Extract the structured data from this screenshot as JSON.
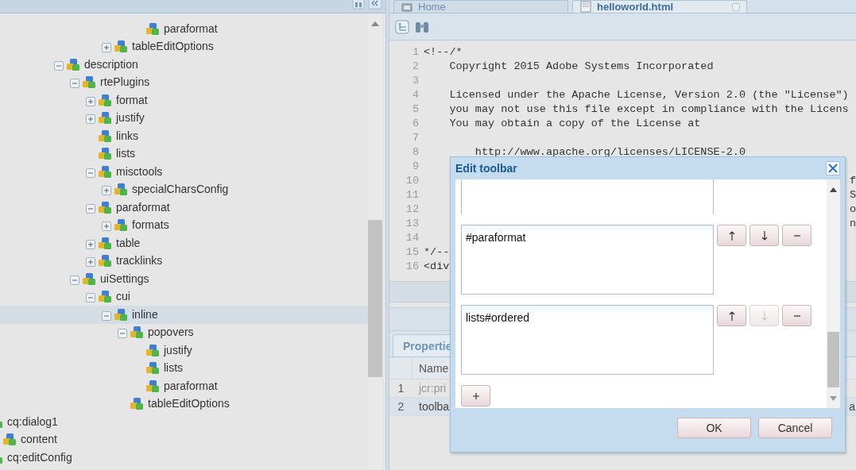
{
  "tree": [
    {
      "label": "paraformat",
      "selected": false
    },
    {
      "label": "tableEditOptions",
      "expanded": false,
      "selected": false
    },
    {
      "label": "description",
      "expanded": true,
      "selected": false,
      "children": [
        {
          "label": "rtePlugins",
          "expanded": true,
          "selected": false,
          "children": [
            {
              "label": "format",
              "expanded": false,
              "selected": false
            },
            {
              "label": "justify",
              "expanded": false,
              "selected": false
            },
            {
              "label": "links",
              "selected": false
            },
            {
              "label": "lists",
              "selected": false
            },
            {
              "label": "misctools",
              "expanded": true,
              "selected": false,
              "children": [
                {
                  "label": "specialCharsConfig",
                  "expanded": false,
                  "selected": false
                }
              ]
            },
            {
              "label": "paraformat",
              "expanded": true,
              "selected": false,
              "children": [
                {
                  "label": "formats",
                  "expanded": false,
                  "selected": false
                }
              ]
            },
            {
              "label": "table",
              "expanded": false,
              "selected": false
            },
            {
              "label": "tracklinks",
              "expanded": false,
              "selected": false
            }
          ]
        },
        {
          "label": "uiSettings",
          "expanded": true,
          "selected": false,
          "children": [
            {
              "label": "cui",
              "expanded": true,
              "selected": false,
              "children": [
                {
                  "label": "inline",
                  "expanded": true,
                  "selected": true,
                  "children": [
                    {
                      "label": "popovers",
                      "expanded": true,
                      "selected": false,
                      "children": [
                        {
                          "label": "justify",
                          "selected": false
                        },
                        {
                          "label": "lists",
                          "selected": false
                        },
                        {
                          "label": "paraformat",
                          "selected": false
                        }
                      ]
                    },
                    {
                      "label": "tableEditOptions",
                      "selected": false
                    }
                  ]
                }
              ]
            }
          ]
        }
      ]
    },
    {
      "label": "cq:dialog1",
      "selected": false
    },
    {
      "label": "content",
      "selected": false
    },
    {
      "label": "cq:editConfig",
      "selected": false
    }
  ],
  "tabs": [
    {
      "label": "Home",
      "kind": "home",
      "selected": false
    },
    {
      "label": "helloworld.html",
      "kind": "file",
      "selected": true
    }
  ],
  "code_lines": [
    {
      "number": "1",
      "text": "<!--/*"
    },
    {
      "number": "2",
      "text": "    Copyright 2015 Adobe Systems Incorporated"
    },
    {
      "number": "3"
    },
    {
      "number": "4",
      "text": "    Licensed under the Apache License, Version 2.0 (the \"License\")"
    },
    {
      "number": "5",
      "text": "    you may not use this file except in compliance with the Licens"
    },
    {
      "number": "6",
      "text": "    You may obtain a copy of the License at"
    },
    {
      "number": "7"
    },
    {
      "number": "8",
      "text": "        http://www.apache.org/licenses/LICENSE-2.0"
    },
    {
      "number": "9"
    },
    {
      "number": "10",
      "tail": "f"
    },
    {
      "number": "11",
      "tail": "S"
    },
    {
      "number": "12",
      "tail": "o"
    },
    {
      "number": "13",
      "tail": "n"
    },
    {
      "number": "14"
    },
    {
      "number": "15",
      "text": "*/--"
    },
    {
      "number": "16",
      "text": "<div"
    }
  ],
  "properties": {
    "tab": "Propertie",
    "columns": [
      "Name"
    ],
    "rows": [
      {
        "index": "1",
        "name": "jcr:pri",
        "selected": false
      },
      {
        "index": "2",
        "name": "toolba",
        "tail": "a",
        "selected": true
      }
    ]
  },
  "dialog": {
    "title": "Edit toolbar",
    "entries": [
      {
        "kind": "clipped"
      },
      {
        "kind": "full",
        "value": "#paraformat",
        "up_disabled": false,
        "down_disabled": false
      },
      {
        "kind": "full",
        "value": "lists#ordered",
        "up_disabled": false,
        "down_disabled": true
      }
    ],
    "buttons": [
      "OK",
      "Cancel"
    ]
  }
}
